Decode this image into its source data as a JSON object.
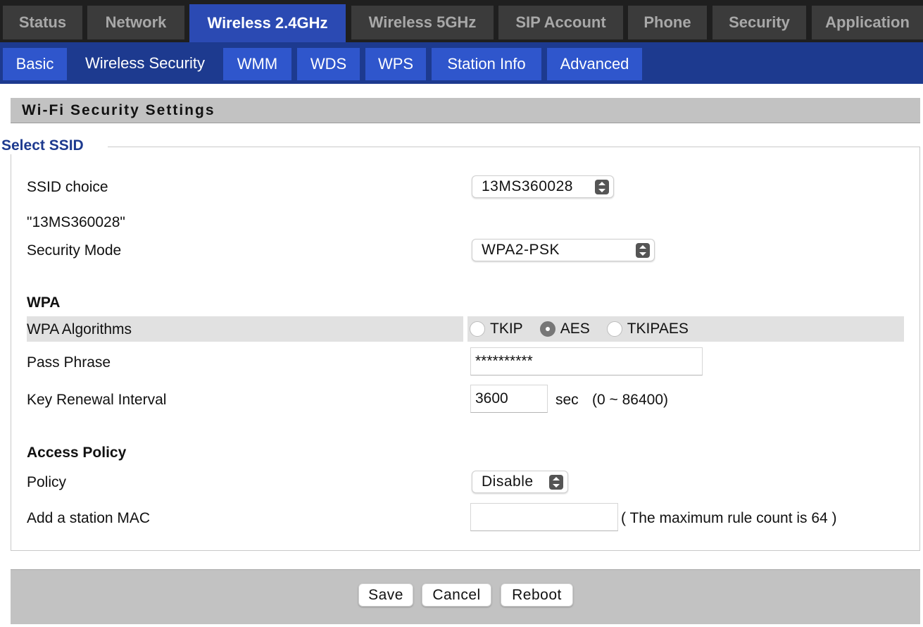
{
  "top_tabs": [
    {
      "label": "Status",
      "active": false
    },
    {
      "label": "Network",
      "active": false
    },
    {
      "label": "Wireless 2.4GHz",
      "active": true
    },
    {
      "label": "Wireless 5GHz",
      "active": false
    },
    {
      "label": "SIP Account",
      "active": false
    },
    {
      "label": "Phone",
      "active": false
    },
    {
      "label": "Security",
      "active": false
    },
    {
      "label": "Application",
      "active": false
    }
  ],
  "sub_tabs": [
    {
      "label": "Basic",
      "active": false
    },
    {
      "label": "Wireless Security",
      "active": true
    },
    {
      "label": "WMM",
      "active": false
    },
    {
      "label": "WDS",
      "active": false
    },
    {
      "label": "WPS",
      "active": false
    },
    {
      "label": "Station Info",
      "active": false
    },
    {
      "label": "Advanced",
      "active": false
    }
  ],
  "section": {
    "title": "Wi-Fi Security Settings"
  },
  "select_ssid": {
    "legend": "Select SSID",
    "ssid_choice_label": "SSID choice",
    "ssid_choice_value": "13MS360028",
    "current_ssid": "\"13MS360028\"",
    "security_mode_label": "Security Mode",
    "security_mode_value": "WPA2-PSK"
  },
  "wpa": {
    "heading": "WPA",
    "algorithms_label": "WPA Algorithms",
    "algorithms": [
      {
        "label": "TKIP",
        "checked": false
      },
      {
        "label": "AES",
        "checked": true
      },
      {
        "label": "TKIPAES",
        "checked": false
      }
    ],
    "pass_phrase_label": "Pass Phrase",
    "pass_phrase_value": "**********",
    "key_renewal_label": "Key Renewal Interval",
    "key_renewal_value": "3600",
    "key_renewal_unit": "sec",
    "key_renewal_range": "(0 ~ 86400)"
  },
  "access_policy": {
    "heading": "Access Policy",
    "policy_label": "Policy",
    "policy_value": "Disable",
    "add_mac_label": "Add a station MAC",
    "add_mac_value": "",
    "max_rule_note": "( The maximum rule count is 64 )"
  },
  "buttons": {
    "save": "Save",
    "cancel": "Cancel",
    "reboot": "Reboot"
  },
  "colors": {
    "top_bar": "#1f1f1f",
    "top_tab_inactive": "#3b3b3b",
    "active_tab": "#2b4ab3",
    "sub_bar": "#1d3a8f",
    "sub_tab": "#2f56cc",
    "legend_text": "#1d3a8f",
    "section_header": "#c2c2c2"
  }
}
